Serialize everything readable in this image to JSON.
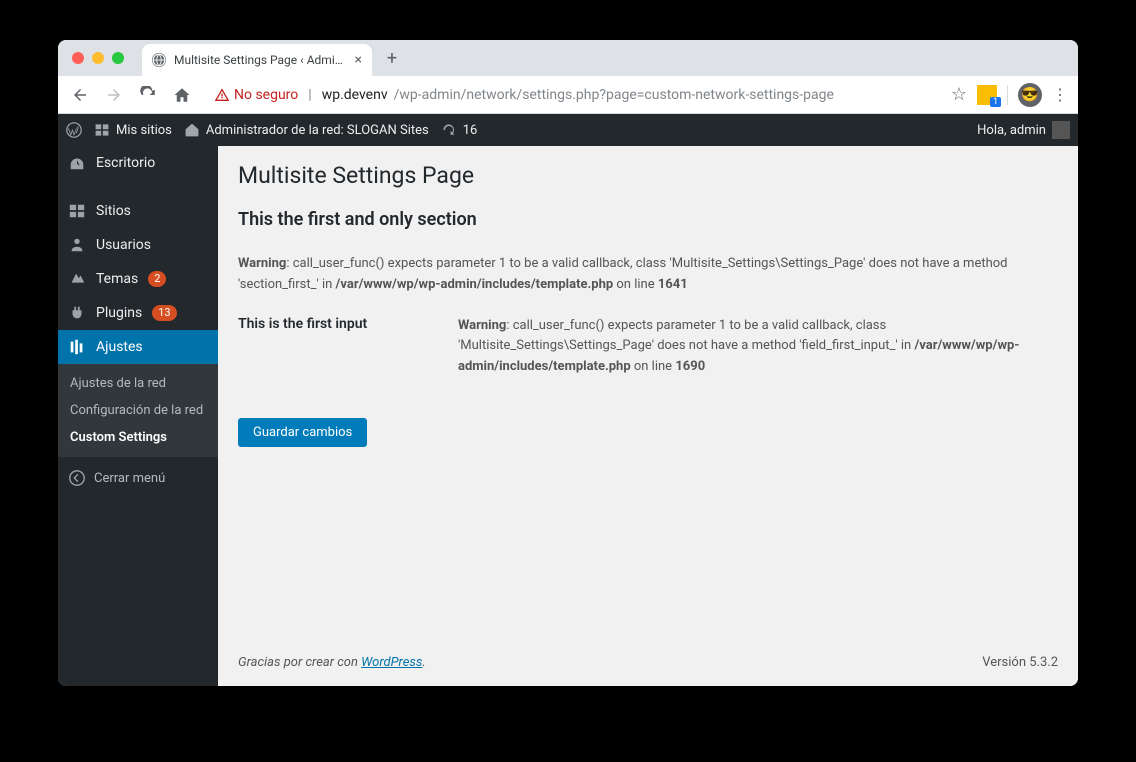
{
  "browser": {
    "tab_title": "Multisite Settings Page ‹ Adminis",
    "not_secure": "No seguro",
    "url_host": "wp.devenv",
    "url_path": "/wp-admin/network/settings.php?page=custom-network-settings-page",
    "ext_badge_count": "1"
  },
  "adminbar": {
    "my_sites": "Mis sitios",
    "network_admin": "Administrador de la red: SLOGAN Sites",
    "updates_count": "16",
    "greeting": "Hola, admin"
  },
  "sidebar": {
    "dashboard": "Escritorio",
    "sites": "Sitios",
    "users": "Usuarios",
    "themes": "Temas",
    "themes_count": "2",
    "plugins": "Plugins",
    "plugins_count": "13",
    "settings": "Ajustes",
    "submenu": {
      "network_settings": "Ajustes de la red",
      "network_setup": "Configuración de la red",
      "custom_settings": "Custom Settings"
    },
    "collapse": "Cerrar menú"
  },
  "content": {
    "title": "Multisite Settings Page",
    "section_title": "This the first and only section",
    "warning1_label": "Warning",
    "warning1_text": ": call_user_func() expects parameter 1 to be a valid callback, class 'Multisite_Settings\\Settings_Page' does not have a method 'section_first_' in ",
    "warning1_file": "/var/www/wp/wp-admin/includes/template.php",
    "warning1_on_line": " on line ",
    "warning1_line": "1641",
    "field_label": "This is the first input",
    "warning2_label": "Warning",
    "warning2_text": ": call_user_func() expects parameter 1 to be a valid callback, class 'Multisite_Settings\\Settings_Page' does not have a method 'field_first_input_' in ",
    "warning2_file": "/var/www/wp/wp-admin/includes/template.php",
    "warning2_on_line": " on line ",
    "warning2_line": "1690",
    "submit": "Guardar cambios"
  },
  "footer": {
    "thanks": "Gracias por crear con ",
    "wordpress": "WordPress",
    "period": ".",
    "version": "Versión 5.3.2"
  }
}
